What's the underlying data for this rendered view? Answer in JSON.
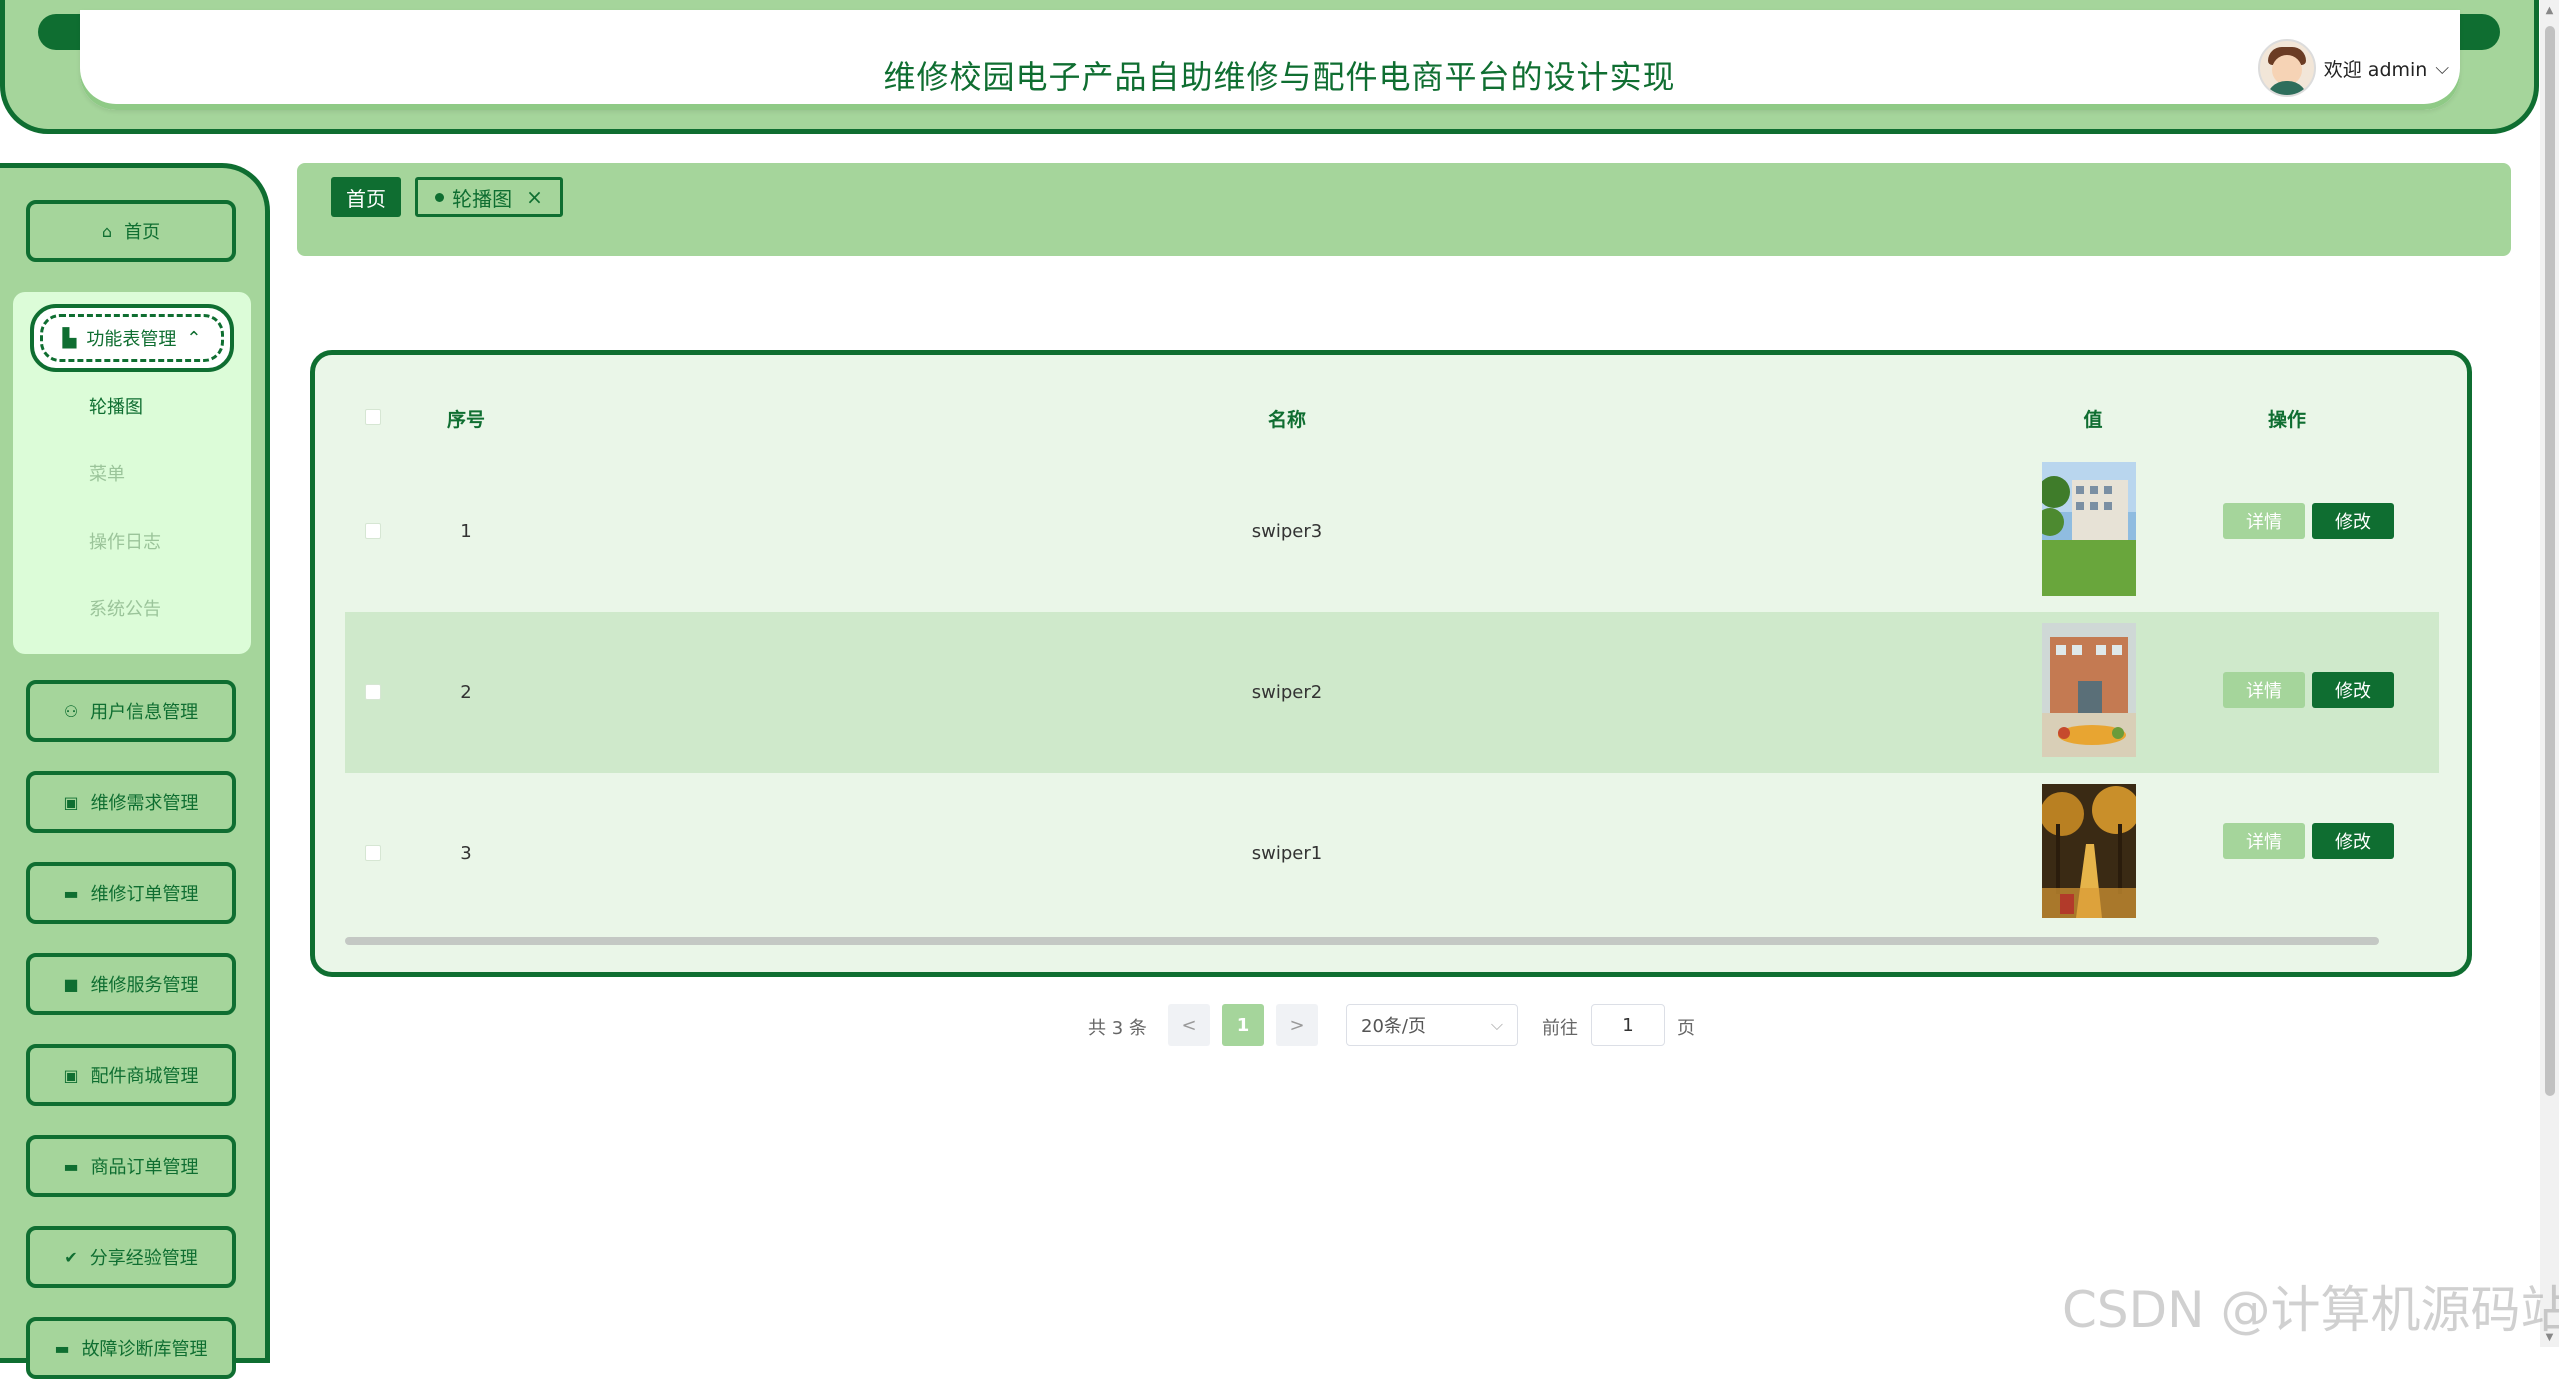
{
  "header": {
    "title": "维修校园电子产品自助维修与配件电商平台的设计实现",
    "welcome": "欢迎 admin",
    "dropdown_icon": "chevron-down-icon"
  },
  "sidebar": {
    "home": {
      "label": "首页",
      "icon": "home-icon"
    },
    "function_menu": {
      "label": "功能表管理",
      "icon": "building-icon",
      "expanded": true
    },
    "submenu": [
      {
        "label": "轮播图",
        "active": true
      },
      {
        "label": "菜单",
        "active": false
      },
      {
        "label": "操作日志",
        "active": false
      },
      {
        "label": "系统公告",
        "active": false
      }
    ],
    "items": [
      {
        "label": "用户信息管理",
        "icon": "user-icon"
      },
      {
        "label": "维修需求管理",
        "icon": "chip-icon"
      },
      {
        "label": "维修订单管理",
        "icon": "order-icon"
      },
      {
        "label": "维修服务管理",
        "icon": "folder-icon"
      },
      {
        "label": "配件商城管理",
        "icon": "chip-icon"
      },
      {
        "label": "商品订单管理",
        "icon": "card-icon"
      },
      {
        "label": "分享经验管理",
        "icon": "check-circle-icon"
      },
      {
        "label": "故障诊断库管理",
        "icon": "order-icon"
      }
    ]
  },
  "breadcrumb": {
    "home": "首页",
    "current": "轮播图"
  },
  "table": {
    "columns": [
      "序号",
      "名称",
      "值",
      "操作"
    ],
    "rows": [
      {
        "index": "1",
        "name": "swiper3",
        "image": "campus-building-photo"
      },
      {
        "index": "2",
        "name": "swiper2",
        "image": "school-entrance-photo"
      },
      {
        "index": "3",
        "name": "swiper1",
        "image": "autumn-path-photo"
      }
    ],
    "detail_label": "详情",
    "edit_label": "修改"
  },
  "pagination": {
    "total": "共 3 条",
    "prev": "<",
    "current": "1",
    "next": ">",
    "page_size": "20条/页",
    "goto_label": "前往",
    "goto_value": "1",
    "page_suffix": "页"
  },
  "watermark": "CSDN @计算机源码站",
  "colors": {
    "primary": "#0f6e31",
    "light": "#a5d59b",
    "panel": "#eaf6e8"
  }
}
